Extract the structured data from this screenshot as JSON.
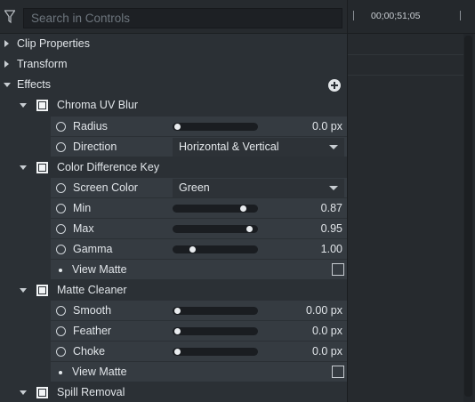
{
  "search": {
    "placeholder": "Search in Controls"
  },
  "timeline": {
    "timecode": "00;00;51;05"
  },
  "groups": {
    "clip_properties": "Clip Properties",
    "transform": "Transform",
    "effects": "Effects"
  },
  "chroma_uv_blur": {
    "title": "Chroma UV Blur",
    "radius": {
      "label": "Radius",
      "value": "0.0 px",
      "level": 0.0
    },
    "direction": {
      "label": "Direction",
      "selected": "Horizontal & Vertical"
    }
  },
  "color_difference_key": {
    "title": "Color Difference Key",
    "screen_color": {
      "label": "Screen Color",
      "selected": "Green"
    },
    "min": {
      "label": "Min",
      "value": "0.87",
      "level": 0.87
    },
    "max": {
      "label": "Max",
      "value": "0.95",
      "level": 0.95
    },
    "gamma": {
      "label": "Gamma",
      "value": "1.00",
      "level": 0.2
    },
    "view_matte": {
      "label": "View Matte"
    }
  },
  "matte_cleaner": {
    "title": "Matte Cleaner",
    "smooth": {
      "label": "Smooth",
      "value": "0.00 px",
      "level": 0.0
    },
    "feather": {
      "label": "Feather",
      "value": "0.0 px",
      "level": 0.0
    },
    "choke": {
      "label": "Choke",
      "value": "0.0 px",
      "level": 0.0
    },
    "view_matte": {
      "label": "View Matte"
    }
  },
  "spill_removal": {
    "title": "Spill Removal"
  },
  "icons": [
    "filter-icon",
    "add-effect-icon",
    "expand-triangle-icon",
    "collapse-triangle-icon",
    "keyframe-toggle-icon",
    "dropdown-caret-icon"
  ]
}
